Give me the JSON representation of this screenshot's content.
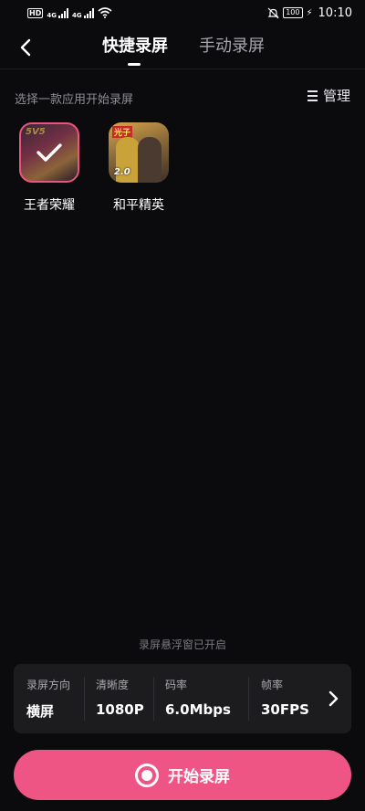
{
  "status_bar": {
    "hd_badge": "HD",
    "signal_1": "4G",
    "signal_2": "4G",
    "battery": "100",
    "time": "10:10"
  },
  "header": {
    "tabs": [
      {
        "label": "快捷录屏",
        "active": true
      },
      {
        "label": "手动录屏",
        "active": false
      }
    ]
  },
  "hint": "选择一款应用开始录屏",
  "manage_label": "管理",
  "apps": [
    {
      "name": "王者荣耀",
      "selected": true,
      "badge": "5V5"
    },
    {
      "name": "和平精英",
      "selected": false,
      "badge": "2.0",
      "flag": "光子"
    }
  ],
  "float_notice": "录屏悬浮窗已开启",
  "settings": [
    {
      "label": "录屏方向",
      "value": "横屏"
    },
    {
      "label": "清晰度",
      "value": "1080P"
    },
    {
      "label": "码率",
      "value": "6.0Mbps"
    },
    {
      "label": "帧率",
      "value": "30FPS"
    }
  ],
  "start_button": "开始录屏",
  "colors": {
    "background": "#0b0b0d",
    "accent": "#ee5584",
    "panel": "#1c1c1f"
  }
}
